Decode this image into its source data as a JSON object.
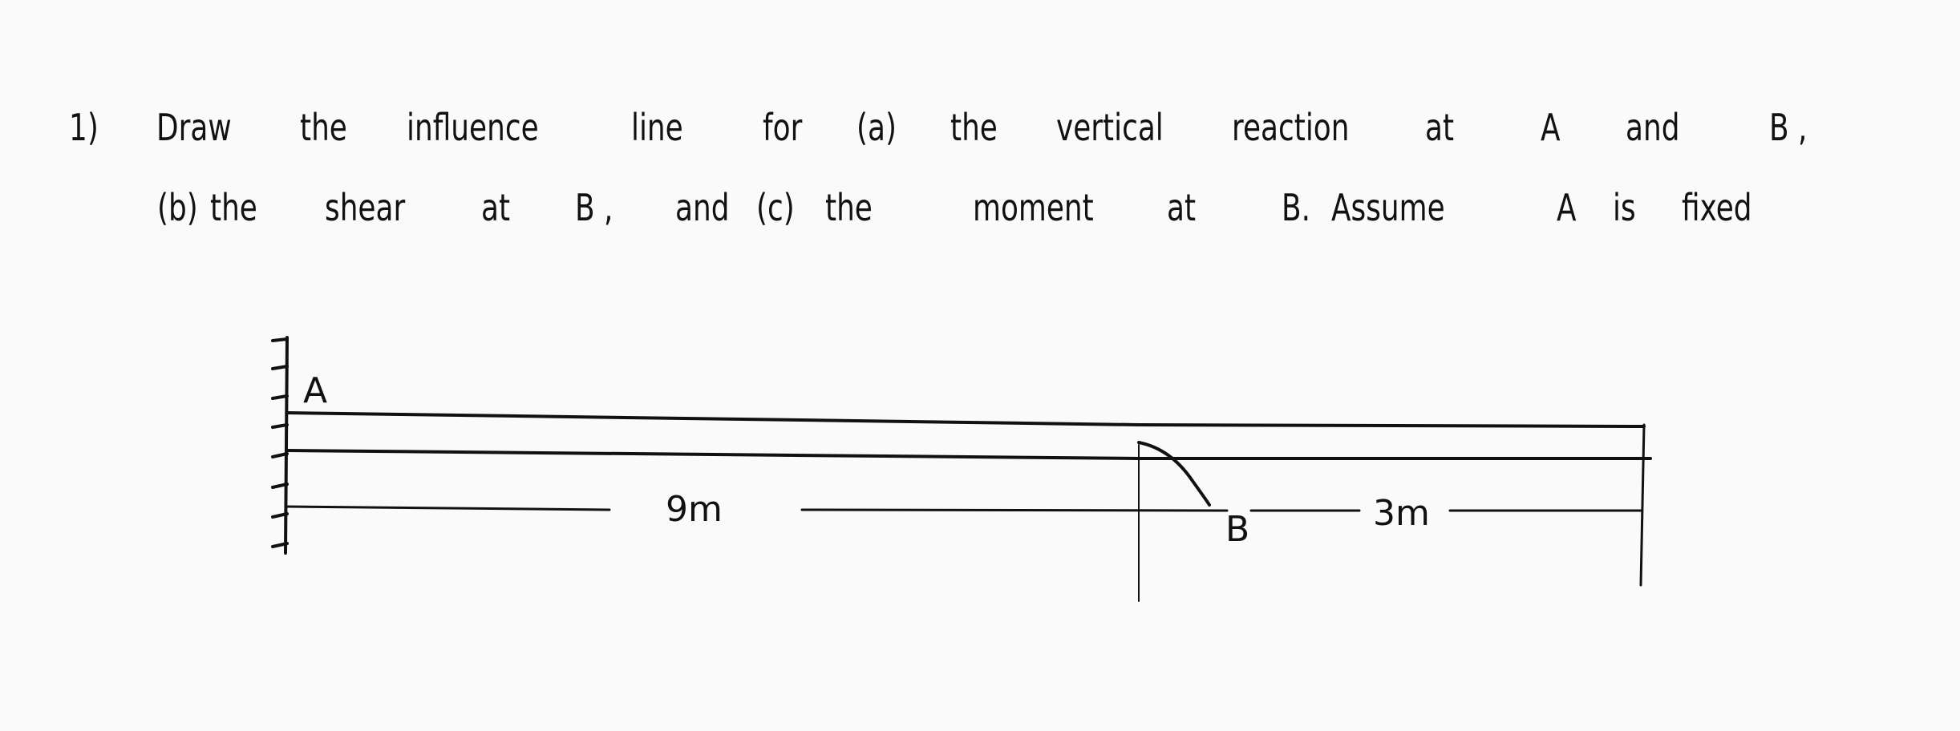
{
  "problem": {
    "number": "1)",
    "line1": [
      "Draw",
      "the",
      "influence",
      "line",
      "for",
      "(a)",
      "the",
      "vertical",
      "reaction",
      "at",
      "A",
      "and",
      "B ,"
    ],
    "line2": [
      "(b)",
      "the",
      "shear",
      "at",
      "B ,",
      "and",
      "(c)",
      "the",
      "moment",
      "at",
      "B.",
      "Assume",
      "A",
      "is",
      "fixed"
    ]
  },
  "diagram": {
    "support_label": "A",
    "point_label": "B",
    "span_left": "9m",
    "span_right": "3m",
    "support_type": "fixed-wall",
    "ink_color": "#111111"
  }
}
